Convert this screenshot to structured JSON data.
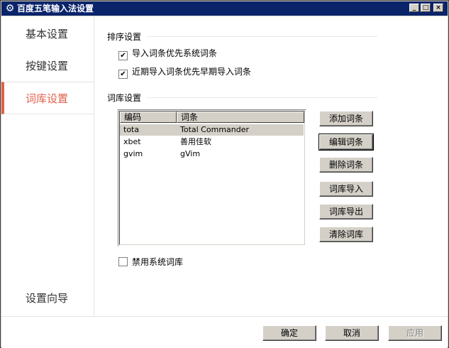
{
  "window": {
    "title": "百度五笔输入法设置",
    "minimize": "_",
    "maximize": "□",
    "close": "×"
  },
  "sidebar": {
    "items": [
      {
        "label": "基本设置"
      },
      {
        "label": "按键设置"
      },
      {
        "label": "词库设置"
      },
      {
        "label": "设置向导"
      }
    ],
    "active_index": 2
  },
  "sort_section": {
    "title": "排序设置",
    "options": [
      {
        "label": "导入词条优先系统词条",
        "checked": true
      },
      {
        "label": "近期导入词条优先早期导入词条",
        "checked": true
      }
    ]
  },
  "lexicon_section": {
    "title": "词库设置",
    "columns": [
      "编码",
      "词条"
    ],
    "rows": [
      {
        "code": "tota",
        "entry": "Total Commander"
      },
      {
        "code": "xbet",
        "entry": "善用佳软"
      },
      {
        "code": "gvim",
        "entry": "gVim"
      }
    ],
    "selected_row": 0,
    "buttons": {
      "add": "添加词条",
      "edit": "编辑词条",
      "delete": "删除词条",
      "import": "词库导入",
      "export": "词库导出",
      "clear": "清除词库"
    },
    "disable_system": {
      "label": "禁用系统词库",
      "checked": false
    }
  },
  "footer": {
    "ok": "确定",
    "cancel": "取消",
    "apply": "应用"
  }
}
